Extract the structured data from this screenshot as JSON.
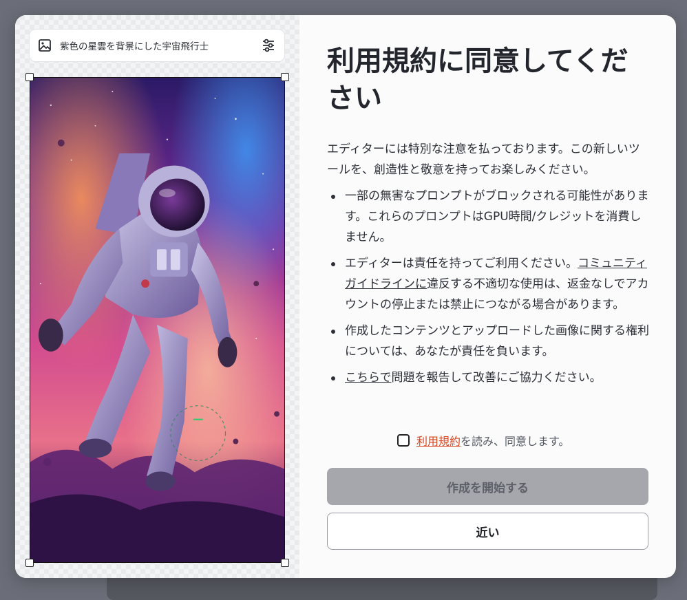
{
  "left_panel": {
    "prompt_text": "紫色の星雲を背景にした宇宙飛行士",
    "image_icon": "image-icon",
    "settings_icon": "sliders-icon"
  },
  "terms": {
    "title": "利用規約に同意してください",
    "intro": "エディターには特別な注意を払っております。この新しいツールを、創造性と敬意を持ってお楽しみください。",
    "bullets": [
      {
        "text": "一部の無害なプロンプトがブロックされる可能性があります。これらのプロンプトはGPU時間/クレジットを消費しません。"
      },
      {
        "text_before": "エディターは責任を持ってご利用ください。",
        "link": "コミュニティガイドラインに",
        "text_after": "違反する不適切な使用は、返金なしでアカウントの停止または禁止につながる場合があります。"
      },
      {
        "text": "作成したコンテンツとアップロードした画像に関する権利については、あなたが責任を負います。"
      },
      {
        "link": "こちらで",
        "text_after": "問題を報告して改善にご協力ください。"
      }
    ],
    "agree_link": "利用規約",
    "agree_text": "を読み、同意します。",
    "agree_checked": false,
    "start_button": "作成を開始する",
    "close_button": "近い",
    "link_color": "#d8461f",
    "disabled_button_color": "#a5a7ad"
  }
}
